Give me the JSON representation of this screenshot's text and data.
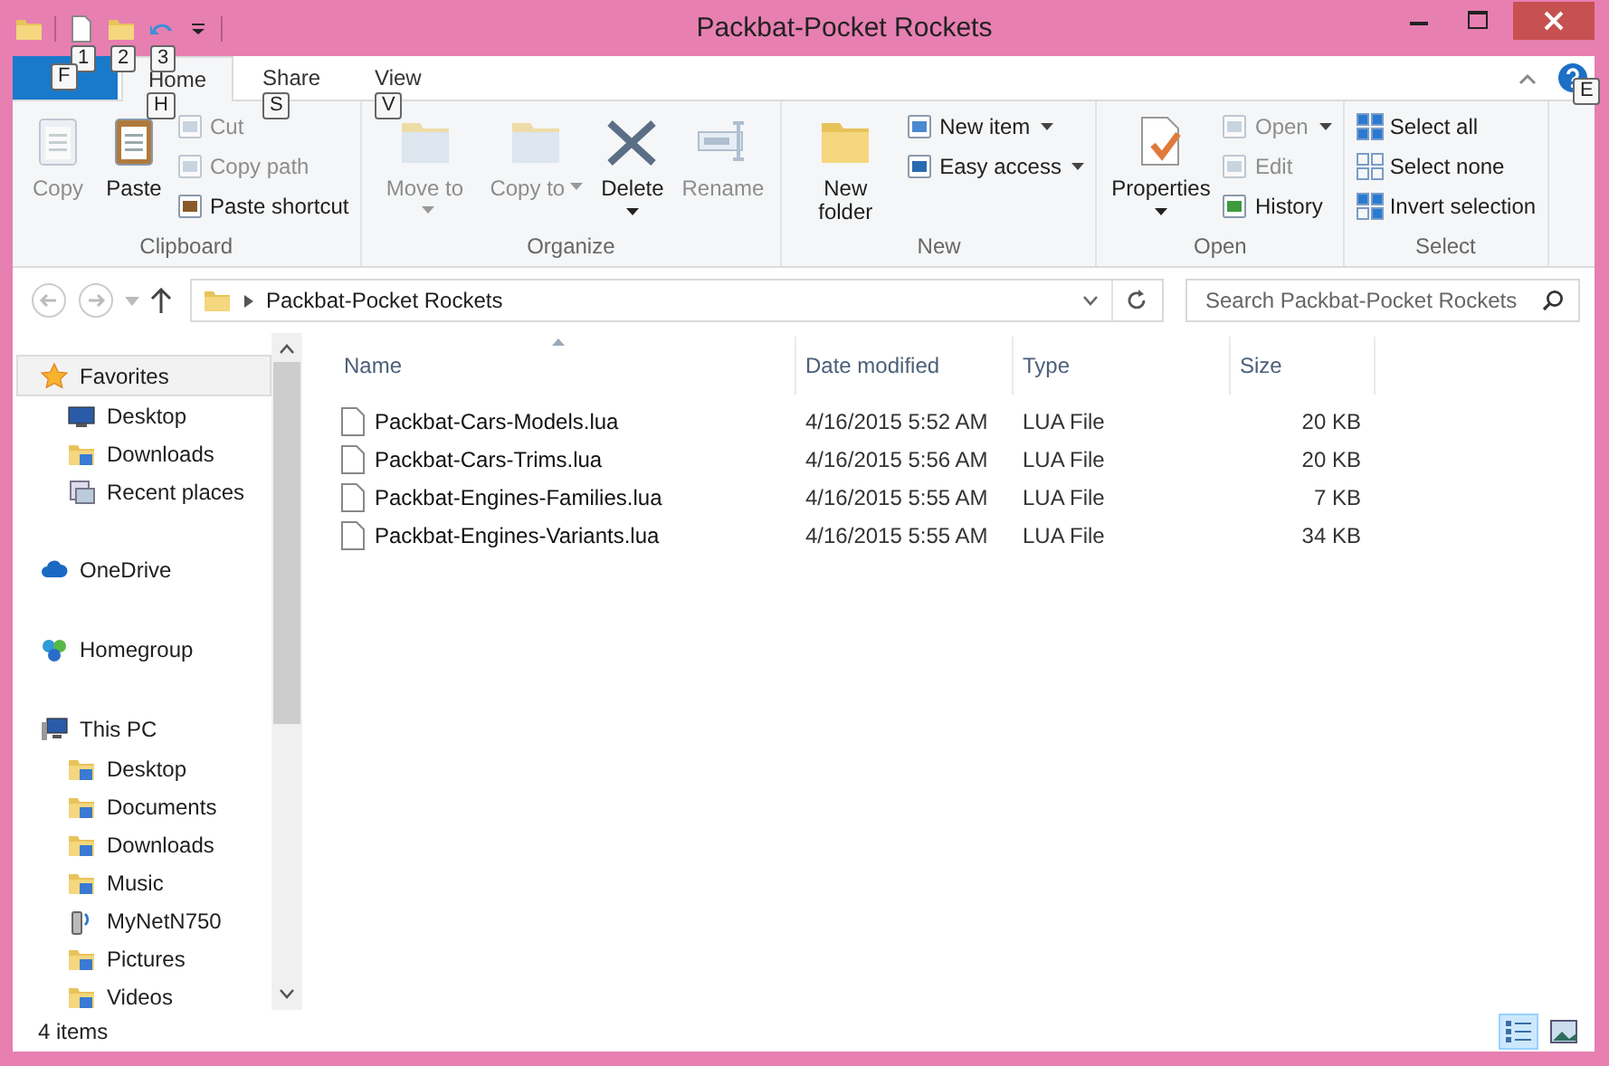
{
  "window": {
    "title": "Packbat-Pocket Rockets"
  },
  "quick_access": [
    {
      "keytip": "1"
    },
    {
      "keytip": "2"
    },
    {
      "keytip": "3"
    }
  ],
  "tabs": [
    {
      "kind": "file",
      "keytip": "F",
      "selected": false
    },
    {
      "kind": "tab",
      "label": "Home",
      "keytip": "H",
      "selected": true
    },
    {
      "kind": "tab",
      "label": "Share",
      "keytip": "S",
      "selected": false
    },
    {
      "kind": "tab",
      "label": "View",
      "keytip": "V",
      "selected": false
    }
  ],
  "help": {
    "keytip": "E"
  },
  "ribbon": [
    {
      "label": "Clipboard",
      "items": [
        {
          "kind": "large",
          "label": "Copy",
          "disabled": true,
          "dropdown": false
        },
        {
          "kind": "large",
          "label": "Paste",
          "disabled": false,
          "dropdown": false
        },
        {
          "kind": "small",
          "label": "Cut",
          "disabled": true,
          "dropdown": false
        },
        {
          "kind": "small",
          "label": "Copy path",
          "disabled": true,
          "dropdown": false
        },
        {
          "kind": "small",
          "label": "Paste shortcut",
          "disabled": false,
          "dropdown": false
        }
      ]
    },
    {
      "label": "Organize",
      "items": [
        {
          "kind": "large",
          "label": "Move to",
          "disabled": true,
          "dropdown": true
        },
        {
          "kind": "large",
          "label": "Copy to",
          "disabled": true,
          "dropdown": true
        },
        {
          "kind": "split",
          "label": "Delete",
          "disabled": false,
          "dropdown": true
        },
        {
          "kind": "large",
          "label": "Rename",
          "disabled": true,
          "dropdown": false
        }
      ]
    },
    {
      "label": "New",
      "items": [
        {
          "kind": "large",
          "label": "New folder",
          "disabled": false,
          "dropdown": false
        },
        {
          "kind": "small",
          "label": "New item",
          "disabled": false,
          "dropdown": true
        },
        {
          "kind": "small",
          "label": "Easy access",
          "disabled": false,
          "dropdown": true
        }
      ]
    },
    {
      "label": "Open",
      "items": [
        {
          "kind": "split",
          "label": "Properties",
          "disabled": false,
          "dropdown": true
        },
        {
          "kind": "small",
          "label": "Open",
          "disabled": true,
          "dropdown": true
        },
        {
          "kind": "small",
          "label": "Edit",
          "disabled": true,
          "dropdown": false
        },
        {
          "kind": "small",
          "label": "History",
          "disabled": false,
          "dropdown": false
        }
      ]
    },
    {
      "label": "Select",
      "items": [
        {
          "kind": "small",
          "label": "Select all",
          "disabled": false,
          "dropdown": false
        },
        {
          "kind": "small",
          "label": "Select none",
          "disabled": false,
          "dropdown": false
        },
        {
          "kind": "small",
          "label": "Invert selection",
          "disabled": false,
          "dropdown": false
        }
      ]
    }
  ],
  "address_bar": {
    "path": "Packbat-Pocket Rockets"
  },
  "search": {
    "placeholder": "Search Packbat-Pocket Rockets"
  },
  "navigation": [
    {
      "label": "Favorites",
      "selected": true,
      "children": [
        {
          "label": "Desktop",
          "selected": false
        },
        {
          "label": "Downloads",
          "selected": false
        },
        {
          "label": "Recent places",
          "selected": false
        }
      ]
    },
    {
      "label": "OneDrive",
      "selected": false
    },
    {
      "label": "Homegroup",
      "selected": false
    },
    {
      "label": "This PC",
      "selected": false,
      "children": [
        {
          "label": "Desktop",
          "selected": false
        },
        {
          "label": "Documents",
          "selected": false
        },
        {
          "label": "Downloads",
          "selected": false
        },
        {
          "label": "Music",
          "selected": false
        },
        {
          "label": "MyNetN750",
          "selected": false
        },
        {
          "label": "Pictures",
          "selected": false
        },
        {
          "label": "Videos",
          "selected": false
        }
      ]
    }
  ],
  "table": {
    "columns": [
      "Name",
      "Date modified",
      "Type",
      "Size"
    ],
    "rows": [
      [
        "Packbat-Cars-Models.lua",
        "4/16/2015 5:52 AM",
        "LUA File",
        "20 KB"
      ],
      [
        "Packbat-Cars-Trims.lua",
        "4/16/2015 5:56 AM",
        "LUA File",
        "20 KB"
      ],
      [
        "Packbat-Engines-Families.lua",
        "4/16/2015 5:55 AM",
        "LUA File",
        "7 KB"
      ],
      [
        "Packbat-Engines-Variants.lua",
        "4/16/2015 5:55 AM",
        "LUA File",
        "34 KB"
      ]
    ]
  },
  "status_bar": {
    "text": "4 items"
  },
  "views": [
    {
      "selected": true
    },
    {
      "selected": false
    }
  ]
}
